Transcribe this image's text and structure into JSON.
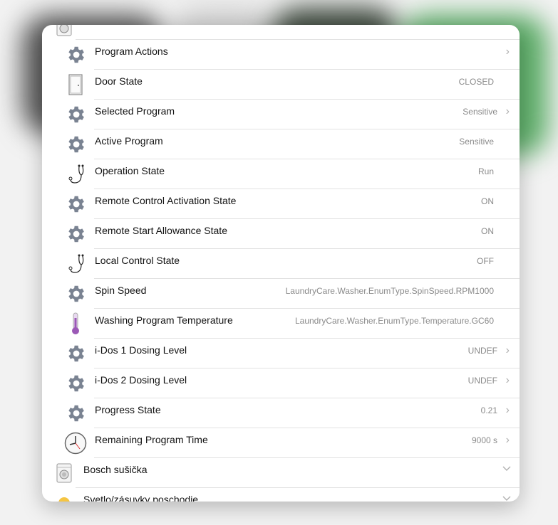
{
  "rows": [
    {
      "label": "Program Actions",
      "value": "",
      "icon": "gear-icon",
      "chevron": true
    },
    {
      "label": "Door State",
      "value": "CLOSED",
      "icon": "door-icon",
      "chevron": false
    },
    {
      "label": "Selected Program",
      "value": "Sensitive",
      "icon": "gear-icon",
      "chevron": true
    },
    {
      "label": "Active Program",
      "value": "Sensitive",
      "icon": "gear-icon",
      "chevron": false
    },
    {
      "label": "Operation State",
      "value": "Run",
      "icon": "stethoscope-icon",
      "chevron": false
    },
    {
      "label": "Remote Control Activation State",
      "value": "ON",
      "icon": "gear-icon",
      "chevron": false
    },
    {
      "label": "Remote Start Allowance State",
      "value": "ON",
      "icon": "gear-icon",
      "chevron": false
    },
    {
      "label": "Local Control State",
      "value": "OFF",
      "icon": "stethoscope-icon",
      "chevron": false
    },
    {
      "label": "Spin Speed",
      "value": "LaundryCare.Washer.EnumType.SpinSpeed.RPM1000",
      "icon": "gear-icon",
      "chevron": false
    },
    {
      "label": "Washing Program Temperature",
      "value": "LaundryCare.Washer.EnumType.Temperature.GC60",
      "icon": "thermometer-icon",
      "chevron": false
    },
    {
      "label": "i-Dos 1 Dosing Level",
      "value": "UNDEF",
      "icon": "gear-icon",
      "chevron": true
    },
    {
      "label": "i-Dos 2 Dosing Level",
      "value": "UNDEF",
      "icon": "gear-icon",
      "chevron": true
    },
    {
      "label": "Progress State",
      "value": "0.21",
      "icon": "gear-icon",
      "chevron": true
    },
    {
      "label": "Remaining Program Time",
      "value": "9000 s",
      "icon": "clock-icon",
      "chevron": true
    }
  ],
  "groups": [
    {
      "label": "Bosch sušička",
      "icon": "washing-machine-icon"
    },
    {
      "label": "Svetlo/zásuvky poschodie",
      "icon": "light-bulb-icon"
    }
  ],
  "colors": {
    "gear": "#7a8392",
    "thermometer": "#9b59b6",
    "bulb": "#f5c542"
  }
}
